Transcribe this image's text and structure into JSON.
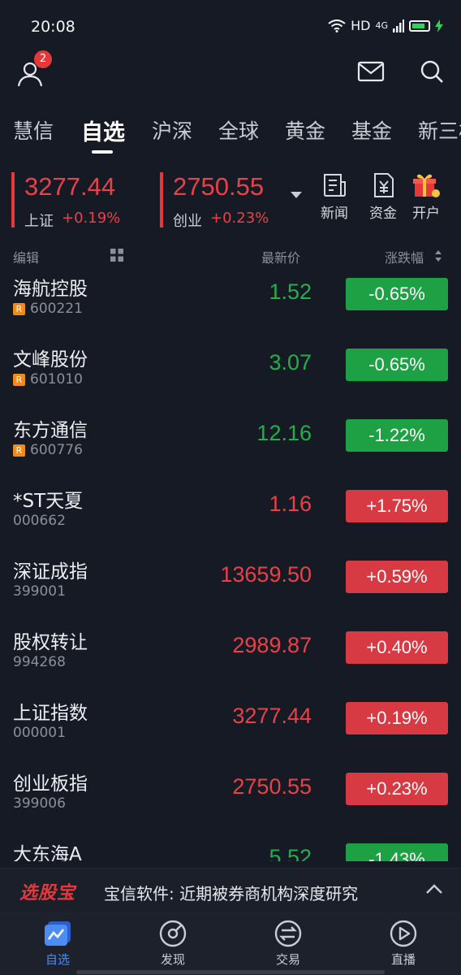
{
  "status": {
    "time": "20:08",
    "network": "HD",
    "signal": "4G"
  },
  "header": {
    "notification_count": "2"
  },
  "tabs": [
    {
      "label": "慧信"
    },
    {
      "label": "自选"
    },
    {
      "label": "沪深"
    },
    {
      "label": "全球"
    },
    {
      "label": "黄金"
    },
    {
      "label": "基金"
    },
    {
      "label": "新三板"
    }
  ],
  "indices": [
    {
      "value": "3277.44",
      "name": "上证",
      "change": "+0.19%"
    },
    {
      "value": "2750.55",
      "name": "创业",
      "change": "+0.23%"
    }
  ],
  "quick_links": [
    {
      "label": "新闻"
    },
    {
      "label": "资金"
    },
    {
      "label": "开户"
    }
  ],
  "list_header": {
    "edit": "编辑",
    "price": "最新价",
    "change": "涨跌幅"
  },
  "stocks": [
    {
      "name": "海航控股",
      "code": "600221",
      "tag": "R",
      "price": "1.52",
      "change": "-0.65%",
      "trend": "down"
    },
    {
      "name": "文峰股份",
      "code": "601010",
      "tag": "R",
      "price": "3.07",
      "change": "-0.65%",
      "trend": "down"
    },
    {
      "name": "东方通信",
      "code": "600776",
      "tag": "R",
      "price": "12.16",
      "change": "-1.22%",
      "trend": "down"
    },
    {
      "name": "*ST天夏",
      "code": "000662",
      "tag": "",
      "price": "1.16",
      "change": "+1.75%",
      "trend": "up"
    },
    {
      "name": "深证成指",
      "code": "399001",
      "tag": "",
      "price": "13659.50",
      "change": "+0.59%",
      "trend": "up"
    },
    {
      "name": "股权转让",
      "code": "994268",
      "tag": "",
      "price": "2989.87",
      "change": "+0.40%",
      "trend": "up"
    },
    {
      "name": "上证指数",
      "code": "000001",
      "tag": "",
      "price": "3277.44",
      "change": "+0.19%",
      "trend": "up"
    },
    {
      "name": "创业板指",
      "code": "399006",
      "tag": "",
      "price": "2750.55",
      "change": "+0.23%",
      "trend": "up"
    },
    {
      "name": "大东海A",
      "code": "",
      "tag": "",
      "price": "5.52",
      "change": "-1.43%",
      "trend": "down"
    }
  ],
  "ticker": {
    "brand": "选股宝",
    "message": "宝信软件: 近期被券商机构深度研究"
  },
  "bottom_nav": [
    {
      "label": "自选",
      "icon": "chart-icon",
      "active": true
    },
    {
      "label": "发现",
      "icon": "discover-icon",
      "active": false
    },
    {
      "label": "交易",
      "icon": "trade-icon",
      "active": false
    },
    {
      "label": "直播",
      "icon": "play-icon",
      "active": false
    }
  ],
  "colors": {
    "up": "#ea4148",
    "down": "#22b04b",
    "accent": "#4d8cf5",
    "background": "#161a24"
  }
}
